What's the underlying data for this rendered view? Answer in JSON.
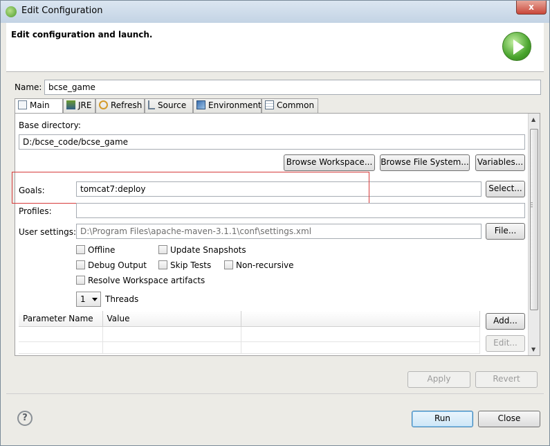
{
  "window": {
    "title": "Edit Configuration",
    "close_label": "x"
  },
  "header": {
    "title": "Edit configuration and launch."
  },
  "name": {
    "label": "Name:",
    "value": "bcse_game"
  },
  "tabs": [
    {
      "label": "Main",
      "icon": "main-tab-icon"
    },
    {
      "label": "JRE",
      "icon": "jre-icon"
    },
    {
      "label": "Refresh",
      "icon": "refresh-icon"
    },
    {
      "label": "Source",
      "icon": "source-icon"
    },
    {
      "label": "Environment",
      "icon": "environment-icon"
    },
    {
      "label": "Common",
      "icon": "common-icon"
    }
  ],
  "main": {
    "base_dir_label": "Base directory:",
    "base_dir_value": "D:/bcse_code/bcse_game",
    "browse_workspace": "Browse Workspace...",
    "browse_fs": "Browse File System...",
    "variables": "Variables...",
    "goals_label": "Goals:",
    "goals_value": "tomcat7:deploy",
    "select": "Select...",
    "profiles_label": "Profiles:",
    "profiles_value": "",
    "user_settings_label": "User settings:",
    "user_settings_value": "D:\\Program Files\\apache-maven-3.1.1\\conf\\settings.xml",
    "file": "File...",
    "options": {
      "offline": "Offline",
      "update_snapshots": "Update Snapshots",
      "debug_output": "Debug Output",
      "skip_tests": "Skip Tests",
      "non_recursive": "Non-recursive",
      "resolve_workspace": "Resolve Workspace artifacts"
    },
    "threads_value": "1",
    "threads_label": "Threads",
    "params_columns": [
      "Parameter Name",
      "Value"
    ],
    "add": "Add...",
    "edit": "Edit..."
  },
  "footer": {
    "apply": "Apply",
    "revert": "Revert",
    "help": "?",
    "run": "Run",
    "close": "Close"
  }
}
